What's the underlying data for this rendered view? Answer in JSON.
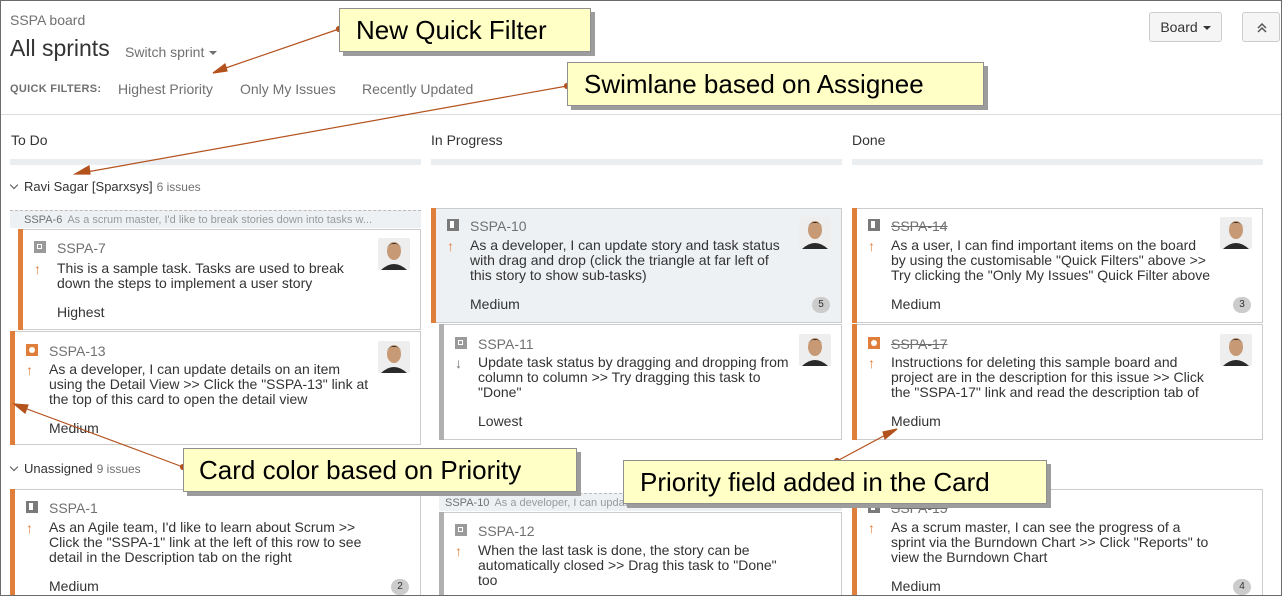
{
  "header": {
    "board_name": "SSPA board",
    "sprint_title": "All sprints",
    "switch_sprint": "Switch sprint",
    "board_button": "Board",
    "quick_filters_label": "QUICK FILTERS:",
    "quick_filters": [
      "Highest Priority",
      "Only My Issues",
      "Recently Updated"
    ]
  },
  "columns": [
    "To Do",
    "In Progress",
    "Done"
  ],
  "swimlanes": [
    {
      "name": "Ravi Sagar [Sparxsys]",
      "count": "6 issues"
    },
    {
      "name": "Unassigned",
      "count": "9 issues"
    }
  ],
  "parents": {
    "p1": {
      "key": "SSPA-6",
      "desc": "As a scrum master, I'd like to break stories down into tasks w..."
    },
    "p2": {
      "key": "SSPA-10",
      "desc": "As a developer, I can update task status w..."
    }
  },
  "cards": {
    "sspa7": {
      "key": "SSPA-7",
      "type": "task",
      "priority_icon": "arrow-up",
      "summary_l1": "This is a sample task. Tasks are used to break",
      "summary_l2": "down the steps to implement a user story",
      "summary_l3": "",
      "priority": "Highest",
      "badge": ""
    },
    "sspa13": {
      "key": "SSPA-13",
      "type": "bug",
      "priority_icon": "arrow-up",
      "summary_l1": "As a developer, I can update details on an item",
      "summary_l2": "using the Detail View >> Click the \"SSPA-13\" link at",
      "summary_l3": "the top of this card to open the detail view",
      "priority": "Medium",
      "badge": ""
    },
    "sspa10": {
      "key": "SSPA-10",
      "type": "story",
      "priority_icon": "arrow-up",
      "summary_l1": "As a developer, I can update story and task status",
      "summary_l2": "with drag and drop (click the triangle at far left of",
      "summary_l3": "this story to show sub-tasks)",
      "priority": "Medium",
      "badge": "5"
    },
    "sspa11": {
      "key": "SSPA-11",
      "type": "task",
      "priority_icon": "arrow-down",
      "summary_l1": "Update task status by dragging and dropping from",
      "summary_l2": "column to column >> Try dragging this task to",
      "summary_l3": "\"Done\"",
      "priority": "Lowest",
      "badge": ""
    },
    "sspa14": {
      "key": "SSPA-14",
      "type": "story",
      "priority_icon": "arrow-up",
      "summary_l1": "As a user, I can find important items on the board",
      "summary_l2": "by using the customisable \"Quick Filters\" above >>",
      "summary_l3": "Try clicking the \"Only My Issues\" Quick Filter above",
      "priority": "Medium",
      "badge": "3"
    },
    "sspa17": {
      "key": "SSPA-17",
      "type": "bug",
      "priority_icon": "arrow-up",
      "summary_l1": "Instructions for deleting this sample board and",
      "summary_l2": "project are in the description for this issue >> Click",
      "summary_l3": "the \"SSPA-17\" link and read the description tab of",
      "priority": "Medium",
      "badge": ""
    },
    "sspa1": {
      "key": "SSPA-1",
      "type": "story",
      "priority_icon": "arrow-up",
      "summary_l1": "As an Agile team, I'd like to learn about Scrum >>",
      "summary_l2": "Click the \"SSPA-1\" link at the left of this row to see",
      "summary_l3": "detail in the Description tab on the right",
      "priority": "Medium",
      "badge": "2"
    },
    "sspa12": {
      "key": "SSPA-12",
      "type": "task",
      "priority_icon": "arrow-up",
      "summary_l1": "When the last task is done, the story can be",
      "summary_l2": "automatically closed >> Drag this task to \"Done\"",
      "summary_l3": "too",
      "priority": "",
      "badge": ""
    },
    "sspa15": {
      "key": "SSPA-15",
      "type": "story",
      "priority_icon": "arrow-up",
      "summary_l1": "As a scrum master, I can see the progress of a",
      "summary_l2": "sprint via the Burndown Chart >> Click \"Reports\" to",
      "summary_l3": "view the Burndown Chart",
      "priority": "Medium",
      "badge": "4"
    }
  },
  "callouts": {
    "new_quick_filter": "New Quick Filter",
    "swimlane": "Swimlane based on Assignee",
    "card_color": "Card color based on Priority",
    "priority_field": "Priority field added in the Card"
  },
  "colors": {
    "priority_accent": "#e07f3c",
    "callout_bg": "#ffffc6",
    "pointer": "#b4521e"
  }
}
